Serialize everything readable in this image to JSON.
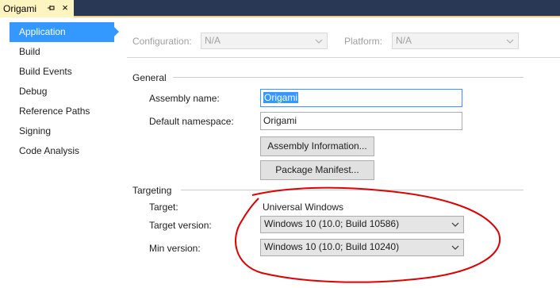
{
  "document_tab": {
    "title": "Origami",
    "pin_icon": "pin-icon",
    "close_icon": "close-icon",
    "close_glyph": "×"
  },
  "nav": {
    "items": [
      {
        "label": "Application",
        "selected": true
      },
      {
        "label": "Build",
        "selected": false
      },
      {
        "label": "Build Events",
        "selected": false
      },
      {
        "label": "Debug",
        "selected": false
      },
      {
        "label": "Reference Paths",
        "selected": false
      },
      {
        "label": "Signing",
        "selected": false
      },
      {
        "label": "Code Analysis",
        "selected": false
      }
    ]
  },
  "config_bar": {
    "configuration_label": "Configuration:",
    "configuration_value": "N/A",
    "platform_label": "Platform:",
    "platform_value": "N/A"
  },
  "general": {
    "title": "General",
    "assembly_name_label": "Assembly name:",
    "assembly_name_value": "Origami",
    "default_namespace_label": "Default namespace:",
    "default_namespace_value": "Origami",
    "assembly_info_button": "Assembly Information...",
    "package_manifest_button": "Package Manifest..."
  },
  "targeting": {
    "title": "Targeting",
    "target_label": "Target:",
    "target_value": "Universal Windows",
    "target_version_label": "Target version:",
    "target_version_value": "Windows 10 (10.0; Build 10586)",
    "min_version_label": "Min version:",
    "min_version_value": "Windows 10 (10.0; Build 10240)"
  },
  "colors": {
    "accent": "#3399ff",
    "tab_active": "#fdf4bf",
    "tab_strip": "#293955",
    "annotation": "#e00000"
  }
}
